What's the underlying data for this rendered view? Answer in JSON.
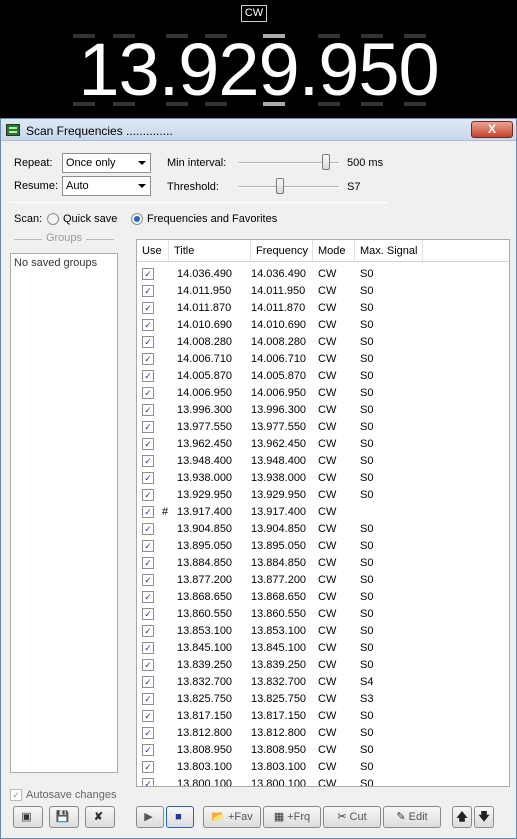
{
  "header": {
    "mode": "CW",
    "frequency": "13.929.950"
  },
  "window": {
    "title": "Scan Frequencies ..............",
    "close_label": "X"
  },
  "settings": {
    "repeat_label": "Repeat:",
    "repeat_value": "Once only",
    "resume_label": "Resume:",
    "resume_value": "Auto",
    "min_interval_label": "Min interval:",
    "min_interval_value": "500 ms",
    "min_interval_level": 0.9,
    "threshold_label": "Threshold:",
    "threshold_value": "S7",
    "threshold_level": 0.4
  },
  "scan": {
    "label": "Scan:",
    "options": [
      {
        "label": "Quick save",
        "selected": false
      },
      {
        "label": "Frequencies and Favorites",
        "selected": true
      }
    ]
  },
  "groups": {
    "title": "Groups",
    "empty_text": "No saved groups",
    "autosave_label": "Autosave changes",
    "autosave_checked": true
  },
  "table": {
    "columns": [
      "Use",
      "Title",
      "Frequency",
      "Mode",
      "Max. Signal"
    ],
    "rows": [
      {
        "use": true,
        "marker": "",
        "title": "14.036.490",
        "frequency": "14.036.490",
        "mode": "CW",
        "signal": "S0"
      },
      {
        "use": true,
        "marker": "",
        "title": "14.011.950",
        "frequency": "14.011.950",
        "mode": "CW",
        "signal": "S0"
      },
      {
        "use": true,
        "marker": "",
        "title": "14.011.870",
        "frequency": "14.011.870",
        "mode": "CW",
        "signal": "S0"
      },
      {
        "use": true,
        "marker": "",
        "title": "14.010.690",
        "frequency": "14.010.690",
        "mode": "CW",
        "signal": "S0"
      },
      {
        "use": true,
        "marker": "",
        "title": "14.008.280",
        "frequency": "14.008.280",
        "mode": "CW",
        "signal": "S0"
      },
      {
        "use": true,
        "marker": "",
        "title": "14.006.710",
        "frequency": "14.006.710",
        "mode": "CW",
        "signal": "S0"
      },
      {
        "use": true,
        "marker": "",
        "title": "14.005.870",
        "frequency": "14.005.870",
        "mode": "CW",
        "signal": "S0"
      },
      {
        "use": true,
        "marker": "",
        "title": "14.006.950",
        "frequency": "14.006.950",
        "mode": "CW",
        "signal": "S0"
      },
      {
        "use": true,
        "marker": "",
        "title": "13.996.300",
        "frequency": "13.996.300",
        "mode": "CW",
        "signal": "S0"
      },
      {
        "use": true,
        "marker": "",
        "title": "13.977.550",
        "frequency": "13.977.550",
        "mode": "CW",
        "signal": "S0"
      },
      {
        "use": true,
        "marker": "",
        "title": "13.962.450",
        "frequency": "13.962.450",
        "mode": "CW",
        "signal": "S0"
      },
      {
        "use": true,
        "marker": "",
        "title": "13.948.400",
        "frequency": "13.948.400",
        "mode": "CW",
        "signal": "S0"
      },
      {
        "use": true,
        "marker": "",
        "title": "13.938.000",
        "frequency": "13.938.000",
        "mode": "CW",
        "signal": "S0"
      },
      {
        "use": true,
        "marker": "",
        "title": "13.929.950",
        "frequency": "13.929.950",
        "mode": "CW",
        "signal": "S0"
      },
      {
        "use": true,
        "marker": "#",
        "title": "13.917.400",
        "frequency": "13.917.400",
        "mode": "CW",
        "signal": ""
      },
      {
        "use": true,
        "marker": "",
        "title": "13.904.850",
        "frequency": "13.904.850",
        "mode": "CW",
        "signal": "S0"
      },
      {
        "use": true,
        "marker": "",
        "title": "13.895.050",
        "frequency": "13.895.050",
        "mode": "CW",
        "signal": "S0"
      },
      {
        "use": true,
        "marker": "",
        "title": "13.884.850",
        "frequency": "13.884.850",
        "mode": "CW",
        "signal": "S0"
      },
      {
        "use": true,
        "marker": "",
        "title": "13.877.200",
        "frequency": "13.877.200",
        "mode": "CW",
        "signal": "S0"
      },
      {
        "use": true,
        "marker": "",
        "title": "13.868.650",
        "frequency": "13.868.650",
        "mode": "CW",
        "signal": "S0"
      },
      {
        "use": true,
        "marker": "",
        "title": "13.860.550",
        "frequency": "13.860.550",
        "mode": "CW",
        "signal": "S0"
      },
      {
        "use": true,
        "marker": "",
        "title": "13.853.100",
        "frequency": "13.853.100",
        "mode": "CW",
        "signal": "S0"
      },
      {
        "use": true,
        "marker": "",
        "title": "13.845.100",
        "frequency": "13.845.100",
        "mode": "CW",
        "signal": "S0"
      },
      {
        "use": true,
        "marker": "",
        "title": "13.839.250",
        "frequency": "13.839.250",
        "mode": "CW",
        "signal": "S0"
      },
      {
        "use": true,
        "marker": "",
        "title": "13.832.700",
        "frequency": "13.832.700",
        "mode": "CW",
        "signal": "S4"
      },
      {
        "use": true,
        "marker": "",
        "title": "13.825.750",
        "frequency": "13.825.750",
        "mode": "CW",
        "signal": "S3"
      },
      {
        "use": true,
        "marker": "",
        "title": "13.817.150",
        "frequency": "13.817.150",
        "mode": "CW",
        "signal": "S0"
      },
      {
        "use": true,
        "marker": "",
        "title": "13.812.800",
        "frequency": "13.812.800",
        "mode": "CW",
        "signal": "S0"
      },
      {
        "use": true,
        "marker": "",
        "title": "13.808.950",
        "frequency": "13.808.950",
        "mode": "CW",
        "signal": "S0"
      },
      {
        "use": true,
        "marker": "",
        "title": "13.803.100",
        "frequency": "13.803.100",
        "mode": "CW",
        "signal": "S0"
      },
      {
        "use": true,
        "marker": "",
        "title": "13.800.100",
        "frequency": "13.800.100",
        "mode": "CW",
        "signal": "S0"
      }
    ]
  },
  "toolbar": {
    "add_fav_label": "+Fav",
    "add_frq_label": "+Frq",
    "cut_label": "Cut",
    "edit_label": "Edit",
    "icons": {
      "new_group": "new-group-icon",
      "save_group": "save-icon",
      "delete_group": "delete-icon",
      "play": "play-icon",
      "stop": "stop-icon",
      "move_up": "arrow-up-icon",
      "move_down": "arrow-down-icon"
    }
  }
}
